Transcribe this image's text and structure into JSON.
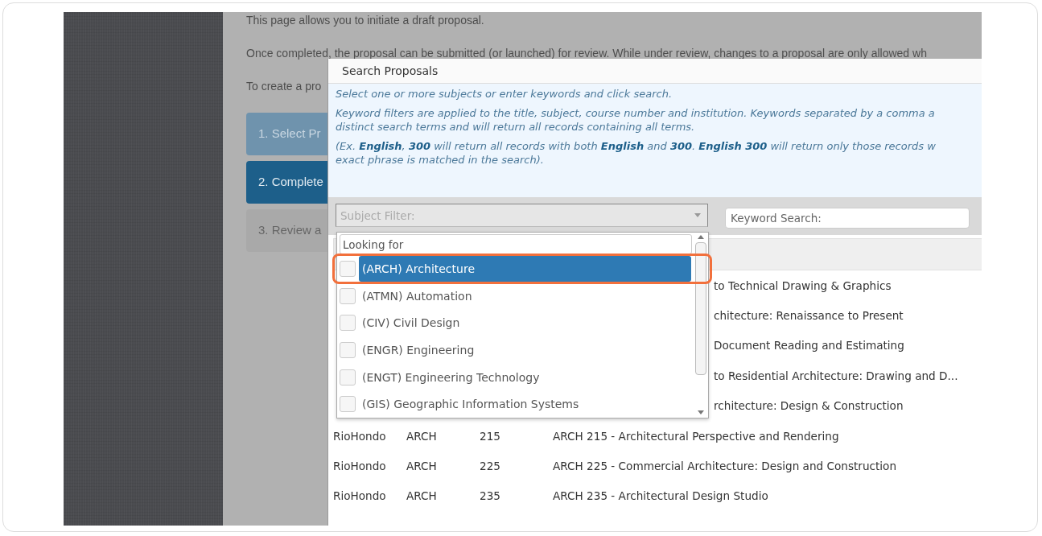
{
  "page": {
    "paragraphs": [
      "This page allows you to initiate a draft proposal.",
      "Once completed, the proposal can be submitted (or launched) for review. While under review, changes to a proposal are only allowed wh",
      "To create a pro"
    ],
    "steps": [
      {
        "label": "1. Select Pr",
        "kind": "done"
      },
      {
        "label": "2. Complete",
        "kind": "current"
      },
      {
        "label": "3. Review a",
        "kind": "upcoming"
      }
    ]
  },
  "dialog": {
    "title": "Search Proposals",
    "instructions": [
      [
        "Select one or more subjects or enter keywords and click search."
      ],
      [
        "Keyword filters are applied to the title, subject, course number and institution. Keywords separated by a comma a",
        "distinct search terms and will return all records containing all terms."
      ],
      [
        "(Ex. **English**, **300** will return all records with both **English** and **300**. **English 300** will return only those records w",
        "exact phrase is matched in the search)."
      ]
    ],
    "subject_filter": {
      "placeholder": "Subject Filter:",
      "expanded": true
    },
    "keyword_search": {
      "placeholder": "Keyword Search:"
    },
    "subject_dropdown": {
      "search_placeholder": "Looking for",
      "highlighted": true,
      "options": [
        {
          "label": "(ARCH) Architecture",
          "checked": false,
          "selected": true
        },
        {
          "label": "(ATMN) Automation",
          "checked": false,
          "selected": false
        },
        {
          "label": "(CIV) Civil Design",
          "checked": false,
          "selected": false
        },
        {
          "label": "(ENGR) Engineering",
          "checked": false,
          "selected": false
        },
        {
          "label": "(ENGT) Engineering Technology",
          "checked": false,
          "selected": false
        },
        {
          "label": "(GIS) Geographic Information Systems",
          "checked": false,
          "selected": false
        }
      ]
    },
    "results": [
      {
        "kind": "covered",
        "title": "to Technical Drawing & Graphics"
      },
      {
        "kind": "covered",
        "title": "chitecture: Renaissance to Present"
      },
      {
        "kind": "covered",
        "title": "Document Reading and Estimating"
      },
      {
        "kind": "covered",
        "title": "to Residential Architecture: Drawing and D..."
      },
      {
        "kind": "covered",
        "title": "rchitecture: Design & Construction"
      },
      {
        "kind": "full",
        "institution": "RioHondo",
        "subject": "ARCH",
        "number": "215",
        "title": "ARCH 215 - Architectural Perspective and Rendering"
      },
      {
        "kind": "full",
        "institution": "RioHondo",
        "subject": "ARCH",
        "number": "225",
        "title": "ARCH 225 - Commercial Architecture: Design and Construction"
      },
      {
        "kind": "full",
        "institution": "RioHondo",
        "subject": "ARCH",
        "number": "235",
        "title": "ARCH 235 - Architectural Design Studio"
      }
    ]
  }
}
